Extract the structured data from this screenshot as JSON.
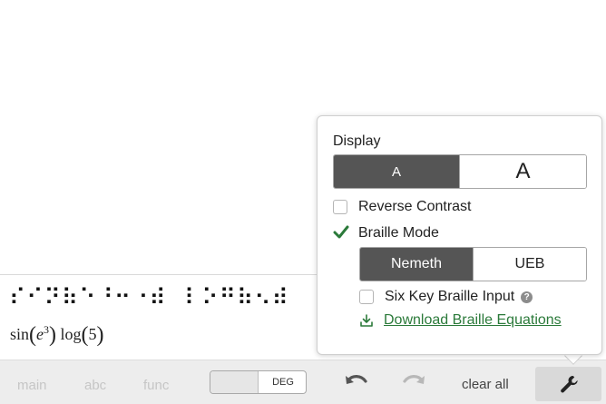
{
  "expression": {
    "braille": "⠎⠊⠝⠷⠑⠘⠒⠐⠾⠀⠇⠕⠛⠷⠢⠾",
    "math": {
      "func1": "sin",
      "base": "e",
      "exponent": "3",
      "func2": "log",
      "arg": "5"
    }
  },
  "keypad": {
    "tabs": [
      "main",
      "abc",
      "func"
    ],
    "angle_toggle_label": "DEG",
    "undo_icon": "undo-icon",
    "redo_icon": "redo-icon",
    "clear_all_label": "clear all",
    "settings_icon": "wrench-icon"
  },
  "settings": {
    "display_label": "Display",
    "font_size_options": [
      "A",
      "A"
    ],
    "font_size_selected": 0,
    "reverse_contrast_label": "Reverse Contrast",
    "reverse_contrast_checked": false,
    "braille_mode_label": "Braille Mode",
    "braille_mode_checked": true,
    "braille_options": [
      "Nemeth",
      "UEB"
    ],
    "braille_selected": 0,
    "six_key_label": "Six Key Braille Input",
    "six_key_checked": false,
    "download_label": "Download Braille Equations"
  },
  "colors": {
    "selected_segment": "#555555",
    "check_green": "#2b7a3a",
    "link_green": "#2b7a3a"
  }
}
